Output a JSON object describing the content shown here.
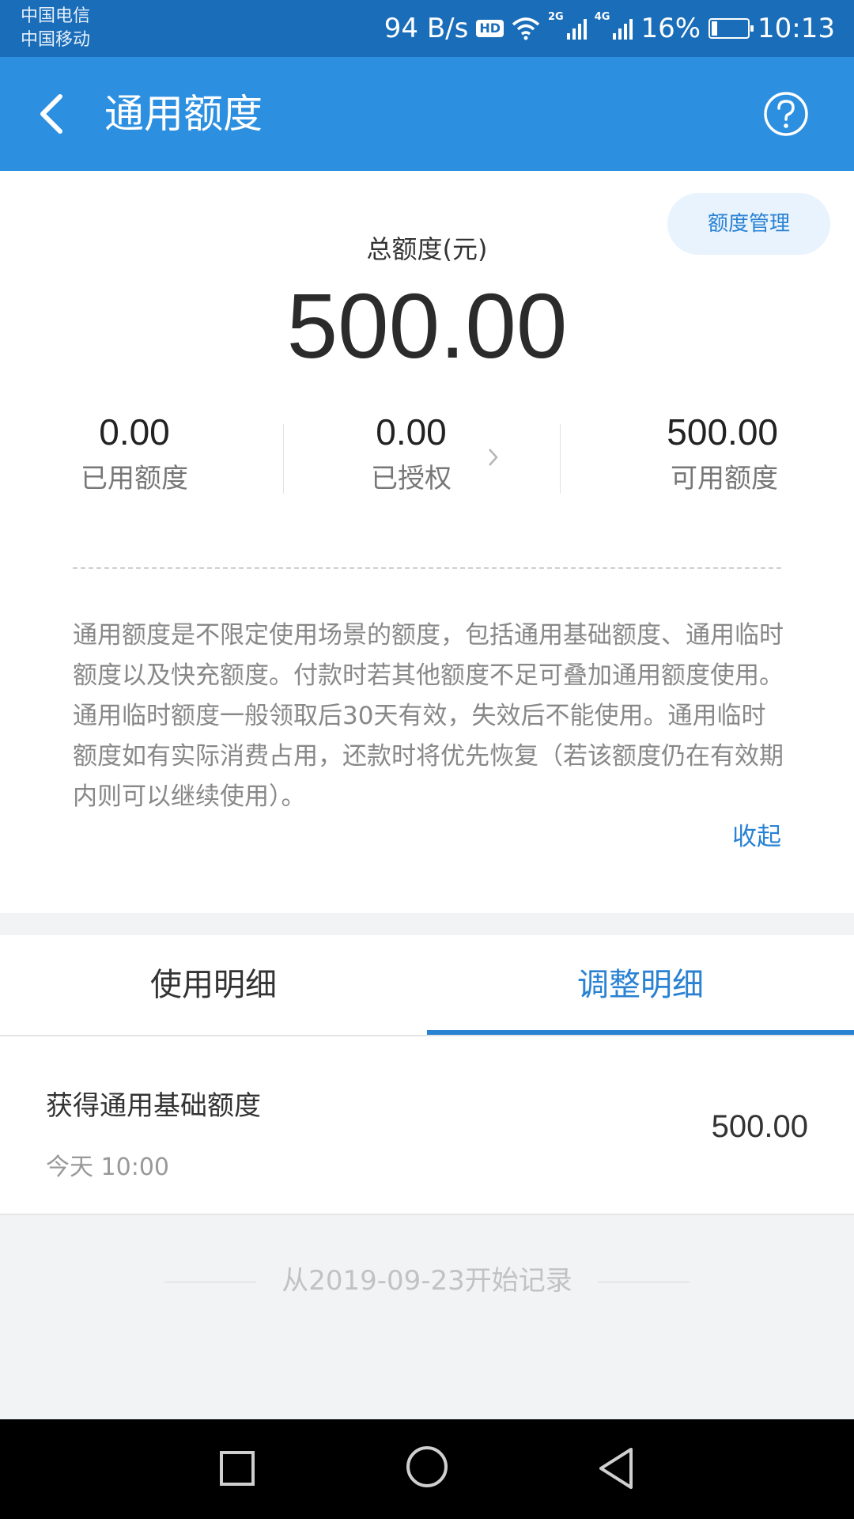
{
  "status_bar": {
    "carrier_1": "中国电信",
    "carrier_2": "中国移动",
    "net_speed": "94 B/s",
    "hd_badge": "HD",
    "net_2g": "2G",
    "net_4g": "4G",
    "battery": "16%",
    "battery_level": 0.16,
    "time": "10:13",
    "icons": [
      "wifi-icon",
      "signal-icon",
      "battery-icon"
    ]
  },
  "header": {
    "title": "通用额度",
    "back_icon": "back-arrow-icon",
    "help_icon": "help-icon",
    "background": "#2d8fe0"
  },
  "summary": {
    "manage_button": "额度管理",
    "total_label": "总额度(元)",
    "total_value": "500.00",
    "stats": [
      {
        "value": "0.00",
        "label": "已用额度"
      },
      {
        "value": "0.00",
        "label": "已授权"
      },
      {
        "value": "500.00",
        "label": "可用额度"
      }
    ],
    "description": "通用额度是不限定使用场景的额度，包括通用基础额度、通用临时额度以及快充额度。付款时若其他额度不足可叠加通用额度使用。通用临时额度一般领取后30天有效，失效后不能使用。通用临时额度如有实际消费占用，还款时将优先恢复（若该额度仍在有效期内则可以继续使用）。",
    "collapse_link": "收起"
  },
  "tabs": [
    {
      "label": "使用明细",
      "active": false
    },
    {
      "label": "调整明细",
      "active": true
    }
  ],
  "records": [
    {
      "title": "获得通用基础额度",
      "time": "今天 10:00",
      "amount": "500.00"
    }
  ],
  "footer_note": "从2019-09-23开始记录",
  "colors": {
    "accent": "#2a82d3",
    "status_bar": "#1a6db9"
  }
}
